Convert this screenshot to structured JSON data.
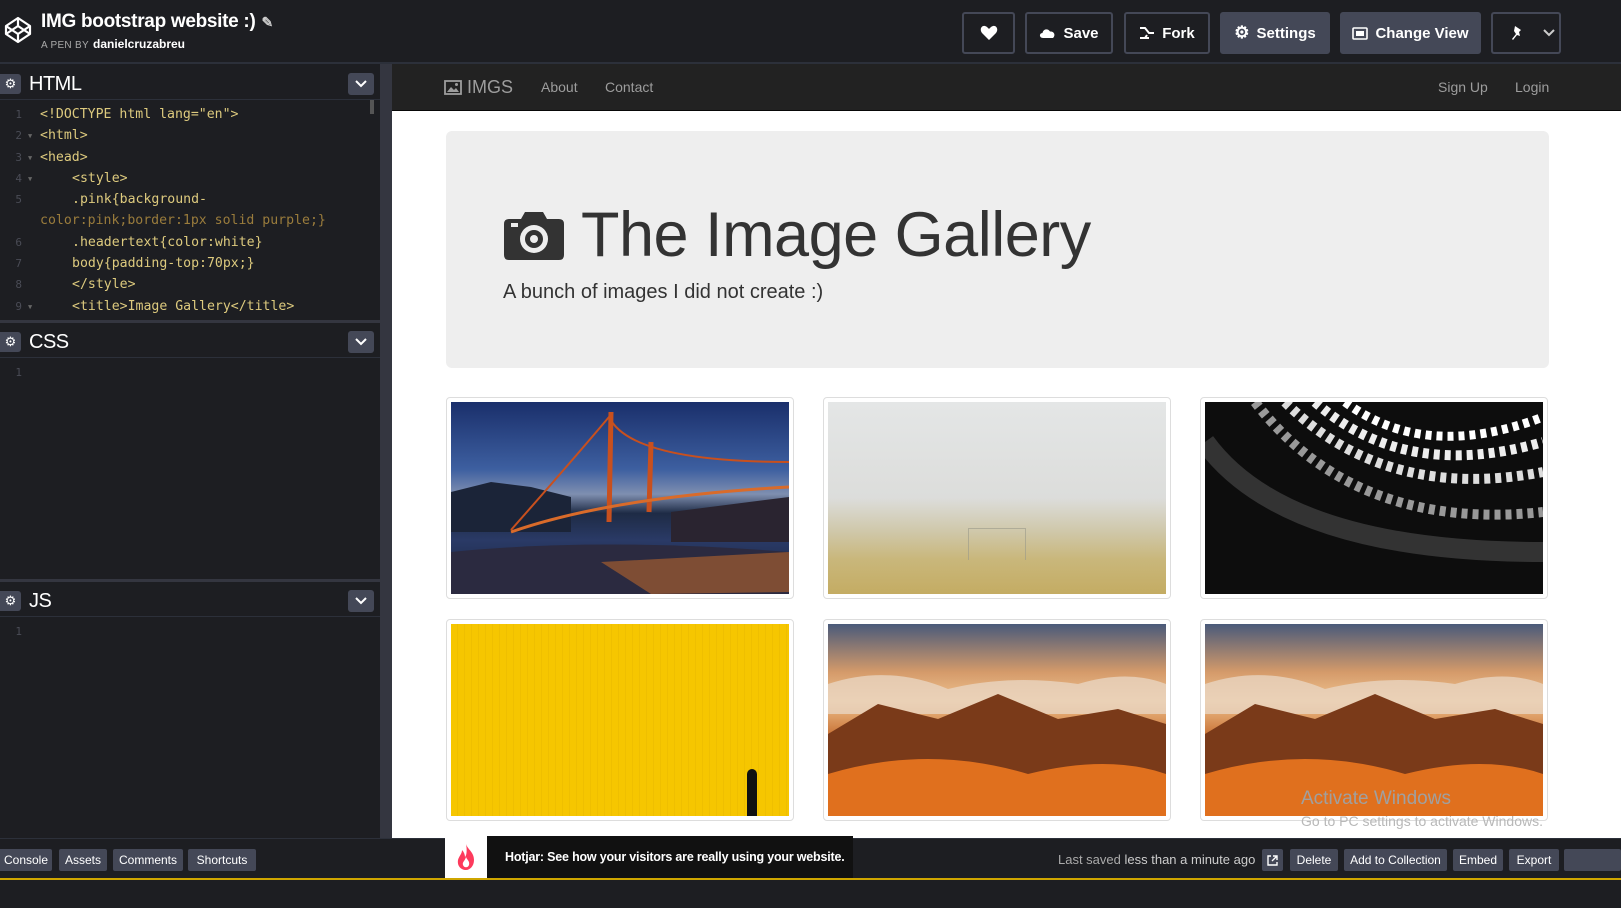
{
  "header": {
    "title": "IMG bootstrap website :)",
    "author_prefix": "A PEN BY",
    "author": "danielcruzabreu",
    "buttons": {
      "save": "Save",
      "fork": "Fork",
      "settings": "Settings",
      "change_view": "Change View"
    }
  },
  "editors": {
    "html": {
      "name": "HTML",
      "lines": [
        {
          "n": "1",
          "text": "<!DOCTYPE html lang=\"en\">"
        },
        {
          "n": "2",
          "text": "<html>"
        },
        {
          "n": "3",
          "text": "<head>"
        },
        {
          "n": "4",
          "text": "<style>"
        },
        {
          "n": "5",
          "text": ".pink{background-"
        },
        {
          "n": "",
          "text": "color:pink;border:1px solid purple;}"
        },
        {
          "n": "6",
          "text": ".headertext{color:white}"
        },
        {
          "n": "7",
          "text": "body{padding-top:70px;}"
        },
        {
          "n": "8",
          "text": "</style>"
        },
        {
          "n": "9",
          "text": "<title>Image Gallery</title>"
        }
      ]
    },
    "css": {
      "name": "CSS",
      "line1": "1"
    },
    "js": {
      "name": "JS",
      "line1": "1"
    }
  },
  "preview": {
    "navbar": {
      "brand": "IMGS",
      "links": [
        "About",
        "Contact"
      ],
      "right_links": [
        "Sign Up",
        "Login"
      ]
    },
    "jumbotron": {
      "title": "The Image Gallery",
      "subtitle": "A bunch of images I did not create :)"
    },
    "images": [
      {
        "subject": "golden-gate-bridge-at-dusk"
      },
      {
        "subject": "foggy-football-field"
      },
      {
        "subject": "black-white-architecture-waves"
      },
      {
        "subject": "yellow-wall-with-person"
      },
      {
        "subject": "mountains-above-clouds-sunset"
      },
      {
        "subject": "mountains-above-clouds-sunset"
      }
    ],
    "watermark": {
      "title": "Activate Windows",
      "subtitle": "Go to PC settings to activate Windows."
    }
  },
  "bottombar": {
    "buttons": [
      "Console",
      "Assets",
      "Comments",
      "Shortcuts"
    ],
    "saved_prefix": "Last saved",
    "saved_time": "less than a minute ago",
    "actions": [
      "Delete",
      "Add to Collection",
      "Embed",
      "Export"
    ]
  },
  "hotjar": {
    "text": "Hotjar: See how your visitors are really using your website."
  },
  "colors": {
    "editor_bg": "#1d1e22",
    "button_bg": "#444857",
    "navbar_bg": "#222222",
    "jumbotron_bg": "#eeeeee"
  }
}
